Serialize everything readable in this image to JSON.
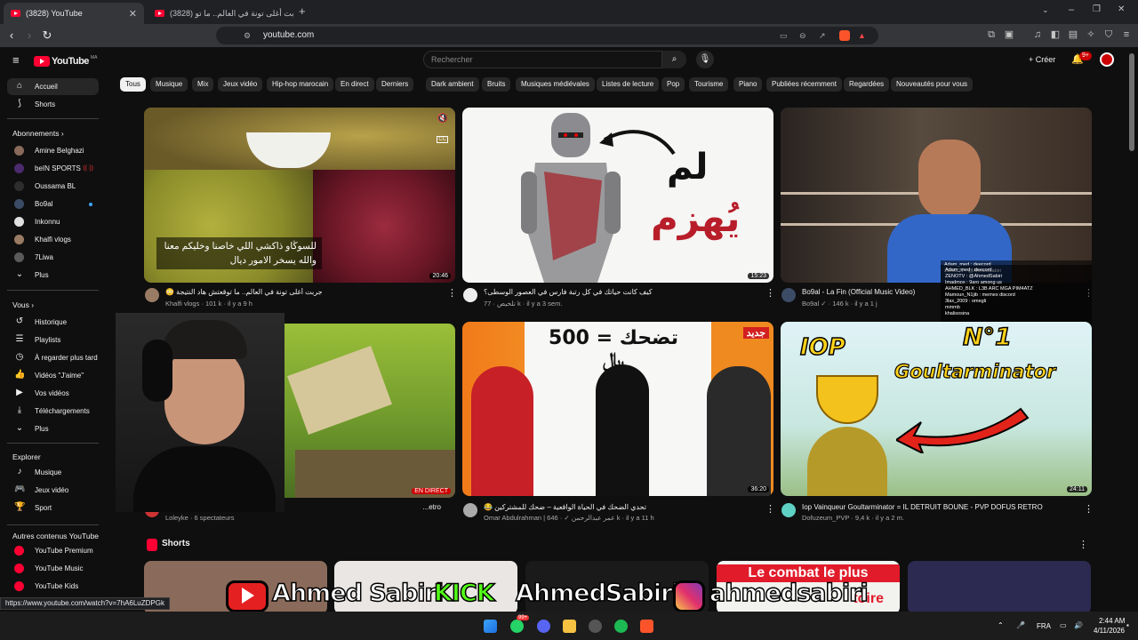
{
  "browser": {
    "tabs": [
      {
        "title": "(3828) YouTube",
        "active": true
      },
      {
        "title": "(3828) جربت أغلى تونة في العالم.. ما تو",
        "active": false
      }
    ],
    "new_tab": "+",
    "url": "youtube.com",
    "status_url": "https://www.youtube.com/watch?v=7hA6LuZDPGk"
  },
  "youtube": {
    "logo_text": "YouTube",
    "logo_suffix": "MA",
    "search_placeholder": "Rechercher",
    "create_label": "Créer",
    "notification_count": "9+",
    "chips": [
      "Tous",
      "Musique",
      "Mix",
      "Jeux vidéo",
      "Hip-hop marocain",
      "En direct",
      "Derniers",
      "Dark ambient",
      "Bruits",
      "Musiques médiévales",
      "Listes de lecture",
      "Pop",
      "Tourisme",
      "Piano",
      "Publiées récemment",
      "Regardées",
      "Nouveautés pour vous"
    ]
  },
  "sidebar": {
    "main": [
      {
        "label": "Accueil",
        "icon": "home-icon"
      },
      {
        "label": "Shorts",
        "icon": "shorts-icon"
      }
    ],
    "subs_header": "Abonnements",
    "subscriptions": [
      {
        "label": "Amine Belghazi",
        "color": "#8a6a5a"
      },
      {
        "label": "beIN SPORTS",
        "color": "#4b2a6d",
        "live": true
      },
      {
        "label": "Oussama BL",
        "color": "#2d2d2d"
      },
      {
        "label": "Bo9al",
        "color": "#3c4c66",
        "dot": true
      },
      {
        "label": "Inkonnu",
        "color": "#e0e0e0"
      },
      {
        "label": "Khalfi vlogs",
        "color": "#9a7b64"
      },
      {
        "label": "7Liwa",
        "color": "#5a5a5a"
      }
    ],
    "subs_more": "Plus",
    "you_header": "Vous",
    "you_items": [
      {
        "label": "Historique",
        "icon": "history-icon"
      },
      {
        "label": "Playlists",
        "icon": "playlist-icon"
      },
      {
        "label": "À regarder plus tard",
        "icon": "watch-later-icon"
      },
      {
        "label": "Vidéos \"J'aime\"",
        "icon": "like-icon"
      },
      {
        "label": "Vos vidéos",
        "icon": "your-videos-icon"
      },
      {
        "label": "Téléchargements",
        "icon": "download-icon"
      }
    ],
    "you_more": "Plus",
    "explore_header": "Explorer",
    "explore_items": [
      {
        "label": "Musique",
        "icon": "music-icon"
      },
      {
        "label": "Jeux vidéo",
        "icon": "gaming-icon"
      },
      {
        "label": "Sport",
        "icon": "trophy-icon"
      }
    ],
    "other_header": "Autres contenus YouTube",
    "other_items": [
      "YouTube Premium",
      "YouTube Music",
      "YouTube Kids"
    ]
  },
  "videos": [
    {
      "title": "جربت أغلى تونة في العالم.. ما توقعتش هاد النتيجة 😳",
      "channel": "Khalfi vlogs",
      "meta": "101 k · il y a 9 h",
      "duration": "20:46",
      "caption_line1": "للسوڭاو ذاكشي اللي خاصنا وخليكم معنا",
      "caption_line2": "والله يسخر الامور ديال"
    },
    {
      "title": "كيف كانت حياتك في كل رتبة فارس في العصور الوسطى؟",
      "channel": "تلخيص",
      "meta": "77 k · il y a 3 sem.",
      "duration": "15:23",
      "thumb_text1": "لم",
      "thumb_text2": "يُهزم"
    },
    {
      "title": "Bo9al - La Fin (Official Music Video)",
      "channel": "Bo9al",
      "meta": "146 k · il y a 1 j",
      "duration": ""
    },
    {
      "title": "...etro",
      "channel": "Loleyke",
      "meta": "6 spectateurs",
      "live_label": "EN DIRECT"
    },
    {
      "title": "تحدي الضحك في الحياة الواقعية – ضحك للمشتركين 😂",
      "channel": "Omar Abdulrahman | عمر عبدالرحمن",
      "meta": "646 k · il y a 11 h",
      "duration": "36:20",
      "thumb_text": "تضحك = 500 ﷼",
      "badge": "جديد"
    },
    {
      "title": "Iop Vainqueur Goultarminator = IL DETRUIT BOUNE - PVP DOFUS RETRO",
      "channel": "Dofuzeum_PVP",
      "meta": "9,4 k · il y a 2 m.",
      "duration": "24:11",
      "thumb_text1": "IOP",
      "thumb_text2": "N°1",
      "thumb_text3": "Goultarminator"
    }
  ],
  "shorts": {
    "header": "Shorts",
    "thumb_text": "Le combat le plus",
    "thumb_text2": "toire"
  },
  "overlay": {
    "handles": [
      "Ahmed Sabiri",
      "KICK",
      "AhmedSabiri",
      "ahmedsabiri"
    ],
    "chat": [
      "Adam_med : deecord",
      "ZENOTV : @AhmedSabiri",
      "Imadmox : 9aro among us",
      "AHMED_BLK : L3B ARC MGA PIM4ATZ",
      "Mamoun_N1jib : memes discord",
      "3lax_2009 : omegli",
      "mmmb",
      "khalisosina"
    ]
  },
  "taskbar": {
    "lang": "FRA",
    "time": "2:44 AM",
    "date": "4/11/2026",
    "whatsapp_badge": "99+"
  }
}
